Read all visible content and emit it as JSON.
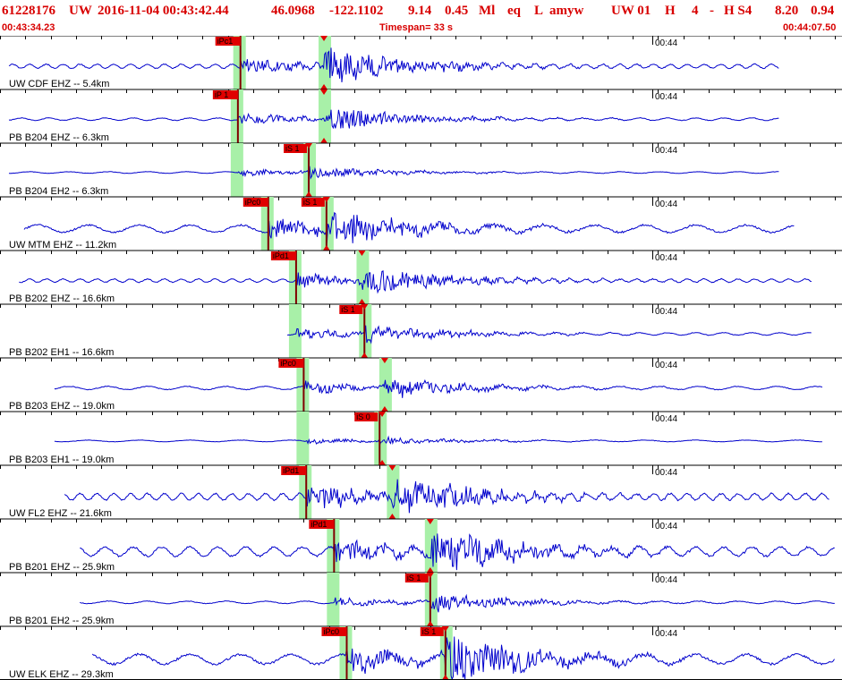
{
  "header": {
    "event_id": "61228176",
    "network": "UW",
    "datetime": "2016-11-04 00:43:42.44",
    "lat": "46.0968",
    "lon": "-122.1102",
    "depth": "9.14",
    "magnitude": "0.45",
    "mag_type": "Ml",
    "etype": "eq",
    "flag": "L",
    "author": "amyw",
    "subsource": "UW 01",
    "quality": "H",
    "count": "4",
    "dash": "-",
    "quality2": "H S4",
    "rms1": "8.20",
    "rms2": "0.94",
    "time_start": "00:43:34.23",
    "timespan": "Timespan=  33 s",
    "time_end": "00:44:07.50"
  },
  "minute_label": "00:44",
  "colors": {
    "trace": "#0000cc",
    "header_text": "#d80000",
    "pick_box": "#e00000",
    "pick_marker": "#e00000",
    "window_band": "#a8f0a8",
    "grid": "#000000"
  },
  "channels": [
    {
      "label": "UW CDF EHZ -- 5.4km",
      "amp": 0.35,
      "burst": 1.6,
      "p_pick": "iPc1",
      "s_pick": "",
      "p_sec": 9.5,
      "s_sec": 12.8,
      "s_marker_sec": 12.8,
      "start_sec": 0.0,
      "end_sec": 30.8,
      "noise": 0.25
    },
    {
      "label": "PB B204 EHZ -- 6.3km",
      "amp": 0.25,
      "burst": 1.5,
      "p_pick": "iP 1",
      "s_pick": "",
      "p_sec": 9.4,
      "s_sec": 12.8,
      "s_marker_sec": 12.8,
      "start_sec": 0.0,
      "end_sec": 30.8,
      "noise": 0.15
    },
    {
      "label": "PB B204 EH2 -- 6.3km",
      "amp": 0.15,
      "burst": 1.2,
      "p_pick": "",
      "s_pick": "iS 1",
      "p_sec": 9.4,
      "s_sec": 12.2,
      "s_marker_sec": 12.2,
      "start_sec": 0.0,
      "end_sec": 30.8,
      "noise": 0.1
    },
    {
      "label": "UW MTM EHZ -- 11.2km",
      "amp": 0.45,
      "burst": 1.3,
      "p_pick": "iPc0",
      "s_pick": "iS 1",
      "p_sec": 10.6,
      "s_sec": 12.9,
      "s_marker_sec": 12.9,
      "start_sec": 0.6,
      "end_sec": 31.4,
      "noise": 0.45
    },
    {
      "label": "PB B202 EHZ -- 16.6km",
      "amp": 0.3,
      "burst": 1.4,
      "p_pick": "iPd1",
      "s_pick": "",
      "p_sec": 11.7,
      "s_sec": 14.3,
      "s_marker_sec": 14.3,
      "start_sec": 0.4,
      "end_sec": 32.1,
      "noise": 0.2
    },
    {
      "label": "PB B202 EH1 -- 16.6km",
      "amp": 0.2,
      "burst": 1.3,
      "p_pick": "",
      "s_pick": "iS 1",
      "p_sec": 11.7,
      "s_sec": 14.4,
      "s_marker_sec": 14.4,
      "start_sec": 11.0,
      "end_sec": 32.1,
      "noise": 0.15
    },
    {
      "label": "PB B203 EHZ -- 19.0km",
      "amp": 0.25,
      "burst": 1.2,
      "p_pick": "iPc0",
      "s_pick": "",
      "p_sec": 12.0,
      "s_sec": 15.2,
      "s_marker_sec": 15.2,
      "start_sec": 1.8,
      "end_sec": 32.5,
      "noise": 0.2
    },
    {
      "label": "PB B203 EH1 -- 19.0km",
      "amp": 0.12,
      "burst": 1.0,
      "p_pick": "",
      "s_pick": "iS 0",
      "p_sec": 12.0,
      "s_sec": 15.0,
      "s_marker_sec": 15.1,
      "start_sec": 1.8,
      "end_sec": 32.5,
      "noise": 0.1
    },
    {
      "label": "UW FL2 EHZ -- 21.6km",
      "amp": 0.55,
      "burst": 1.1,
      "p_pick": "iPd1",
      "s_pick": "",
      "p_sec": 12.1,
      "s_sec": 15.5,
      "s_marker_sec": 15.5,
      "start_sec": 2.2,
      "end_sec": 32.8,
      "noise": 0.4
    },
    {
      "label": "PB B201 EHZ -- 25.9km",
      "amp": 0.55,
      "burst": 1.2,
      "p_pick": "iPd1",
      "s_pick": "",
      "p_sec": 13.2,
      "s_sec": 17.0,
      "s_marker_sec": 17.0,
      "start_sec": 2.8,
      "end_sec": 33.0,
      "noise": 0.55
    },
    {
      "label": "PB B201 EH2 -- 25.9km",
      "amp": 0.2,
      "burst": 1.4,
      "p_pick": "",
      "s_pick": "iS 1",
      "p_sec": 13.2,
      "s_sec": 17.0,
      "s_marker_sec": 17.0,
      "start_sec": 2.8,
      "end_sec": 33.0,
      "noise": 0.15
    },
    {
      "label": "UW ELK EHZ -- 29.3km",
      "amp": 0.6,
      "burst": 1.3,
      "p_pick": "iPc0",
      "s_pick": "iS 1",
      "p_sec": 13.7,
      "s_sec": 17.6,
      "s_marker_sec": 17.6,
      "start_sec": 3.3,
      "end_sec": 33.0,
      "noise": 0.6
    }
  ]
}
